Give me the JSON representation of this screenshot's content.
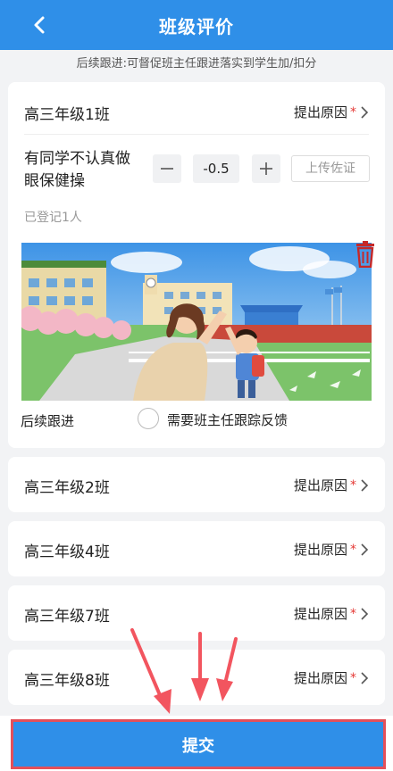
{
  "header": {
    "title": "班级评价",
    "back_icon": "chevron-left-icon"
  },
  "notice": "后续跟进:可督促班主任跟进落实到学生加/扣分",
  "expanded_class": {
    "name": "高三年级1班",
    "reason_label": "提出原因",
    "required_mark": "*",
    "item": {
      "text": "有同学不认真做眼保健操",
      "value": "-0.5",
      "upload_label": "上传佐证"
    },
    "registered": "已登记1人",
    "follow_label": "后续跟进",
    "follow_option": "需要班主任跟踪反馈"
  },
  "classes": [
    {
      "name": "高三年级2班",
      "reason_label": "提出原因",
      "required_mark": "*"
    },
    {
      "name": "高三年级4班",
      "reason_label": "提出原因",
      "required_mark": "*"
    },
    {
      "name": "高三年级7班",
      "reason_label": "提出原因",
      "required_mark": "*"
    },
    {
      "name": "高三年级8班",
      "reason_label": "提出原因",
      "required_mark": "*"
    }
  ],
  "submit_label": "提交",
  "colors": {
    "primary": "#2f8fe8",
    "required": "#e53935",
    "highlight": "#e4505a",
    "trash": "#c62828"
  }
}
